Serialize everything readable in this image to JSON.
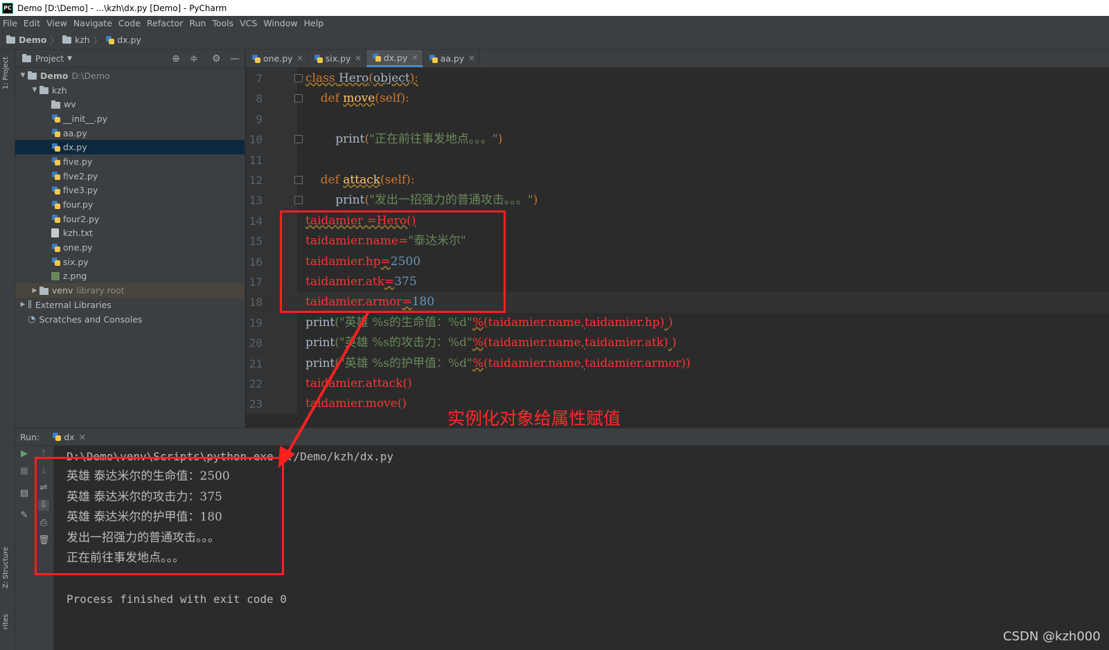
{
  "window": {
    "title": "Demo [D:\\Demo] - ...\\kzh\\dx.py [Demo] - PyCharm",
    "logo_text": "PC"
  },
  "menu": [
    "File",
    "Edit",
    "View",
    "Navigate",
    "Code",
    "Refactor",
    "Run",
    "Tools",
    "VCS",
    "Window",
    "Help"
  ],
  "breadcrumb": {
    "project": "Demo",
    "folder": "kzh",
    "file": "dx.py"
  },
  "left_tool_tabs": {
    "project": "1: Project",
    "structure": "Z: Structure",
    "favorites": "rites"
  },
  "project_panel": {
    "title": "Project",
    "tree": [
      {
        "indent": 0,
        "arrow": "▼",
        "icon": "folder",
        "label": "Demo",
        "extra": "D:\\Demo",
        "bold": true
      },
      {
        "indent": 1,
        "arrow": "▼",
        "icon": "folder",
        "label": "kzh"
      },
      {
        "indent": 2,
        "arrow": "",
        "icon": "folder",
        "label": "wv"
      },
      {
        "indent": 2,
        "arrow": "",
        "icon": "py",
        "label": "__init__.py"
      },
      {
        "indent": 2,
        "arrow": "",
        "icon": "py",
        "label": "aa.py"
      },
      {
        "indent": 2,
        "arrow": "",
        "icon": "py",
        "label": "dx.py",
        "selected": true
      },
      {
        "indent": 2,
        "arrow": "",
        "icon": "py",
        "label": "five.py"
      },
      {
        "indent": 2,
        "arrow": "",
        "icon": "py",
        "label": "five2.py"
      },
      {
        "indent": 2,
        "arrow": "",
        "icon": "py",
        "label": "five3.py"
      },
      {
        "indent": 2,
        "arrow": "",
        "icon": "py",
        "label": "four.py"
      },
      {
        "indent": 2,
        "arrow": "",
        "icon": "py",
        "label": "four2.py"
      },
      {
        "indent": 2,
        "arrow": "",
        "icon": "txt",
        "label": "kzh.txt"
      },
      {
        "indent": 2,
        "arrow": "",
        "icon": "py",
        "label": "one.py"
      },
      {
        "indent": 2,
        "arrow": "",
        "icon": "py",
        "label": "six.py"
      },
      {
        "indent": 2,
        "arrow": "",
        "icon": "img",
        "label": "z.png"
      },
      {
        "indent": 1,
        "arrow": "▶",
        "icon": "folder",
        "label": "venv",
        "extra": "library root",
        "venv": true
      },
      {
        "indent": 0,
        "arrow": "▶",
        "icon": "lib",
        "label": "External Libraries"
      },
      {
        "indent": 0,
        "arrow": "",
        "icon": "scratch",
        "label": "Scratches and Consoles"
      }
    ]
  },
  "editor_tabs": [
    {
      "label": "one.py",
      "active": false
    },
    {
      "label": "six.py",
      "active": false
    },
    {
      "label": "dx.py",
      "active": true
    },
    {
      "label": "aa.py",
      "active": false
    }
  ],
  "code_lines": [
    {
      "num": "7",
      "tokens": [
        [
          "k sq",
          "class "
        ],
        [
          "sq",
          "Hero"
        ],
        [
          "k sq",
          "("
        ],
        [
          "sq",
          "object"
        ],
        [
          "k sq",
          "):"
        ]
      ],
      "fold": true
    },
    {
      "num": "8",
      "tokens": [
        [
          "",
          "    "
        ],
        [
          "k",
          "def "
        ],
        [
          "f sq",
          "move"
        ],
        [
          "k",
          "(self):"
        ]
      ],
      "fold": true
    },
    {
      "num": "9",
      "tokens": []
    },
    {
      "num": "10",
      "tokens": [
        [
          "",
          "        print"
        ],
        [
          "k",
          "("
        ],
        [
          "s",
          "\"正在前往事发地点。。。\""
        ],
        [
          "k",
          ")"
        ]
      ],
      "fold": true
    },
    {
      "num": "11",
      "tokens": []
    },
    {
      "num": "12",
      "tokens": [
        [
          "",
          "    "
        ],
        [
          "k",
          "def "
        ],
        [
          "f sq",
          "attack"
        ],
        [
          "k",
          "(self):"
        ]
      ],
      "fold": true
    },
    {
      "num": "13",
      "tokens": [
        [
          "",
          "        print"
        ],
        [
          "k",
          "("
        ],
        [
          "s",
          "\"发出一招强力的普通攻击。。。\""
        ],
        [
          "k",
          ")"
        ]
      ],
      "fold": true
    },
    {
      "num": "14",
      "tokens": [
        [
          "r sq",
          "taidamier =Hero()"
        ]
      ]
    },
    {
      "num": "15",
      "tokens": [
        [
          "r",
          "taidamier.name="
        ],
        [
          "s",
          "\"泰达米尔\""
        ]
      ]
    },
    {
      "num": "16",
      "tokens": [
        [
          "r",
          "taidamier.hp"
        ],
        [
          "r sq",
          "="
        ],
        [
          "n",
          "2500"
        ]
      ]
    },
    {
      "num": "17",
      "tokens": [
        [
          "r",
          "taidamier.atk"
        ],
        [
          "r sq",
          "="
        ],
        [
          "n",
          "375"
        ]
      ]
    },
    {
      "num": "18",
      "tokens": [
        [
          "r",
          "taidamier.armor"
        ],
        [
          "r sq",
          "="
        ],
        [
          "n",
          "180"
        ]
      ],
      "current": true
    },
    {
      "num": "19",
      "tokens": [
        [
          "",
          "print"
        ],
        [
          "s",
          "(\"英雄 %s的生命值：%d\""
        ],
        [
          "r sq",
          "%"
        ],
        [
          "r",
          "(taidamier.name"
        ],
        [
          "r sq",
          ","
        ],
        [
          "r",
          "taidamier.hp)"
        ],
        [
          "r sq",
          " "
        ],
        [
          "r",
          ")"
        ]
      ]
    },
    {
      "num": "20",
      "tokens": [
        [
          "",
          "print"
        ],
        [
          "s",
          "(\"英雄 %s的攻击力：%d\""
        ],
        [
          "r sq",
          "%"
        ],
        [
          "r",
          "(taidamier.name"
        ],
        [
          "r sq",
          ","
        ],
        [
          "r",
          "taidamier.atk)"
        ],
        [
          "r sq",
          " "
        ],
        [
          "r",
          ")"
        ]
      ]
    },
    {
      "num": "21",
      "tokens": [
        [
          "",
          "print"
        ],
        [
          "s",
          "(\"英雄 %s的护甲值：%d\""
        ],
        [
          "r sq",
          "%"
        ],
        [
          "r",
          "(taidamier.name"
        ],
        [
          "r sq",
          ","
        ],
        [
          "r",
          "taidamier.armor))"
        ]
      ]
    },
    {
      "num": "22",
      "tokens": [
        [
          "r",
          "taidamier.attack()"
        ]
      ]
    },
    {
      "num": "23",
      "tokens": [
        [
          "r",
          "taidamier.move()"
        ]
      ]
    }
  ],
  "run_panel": {
    "label": "Run:",
    "tab": "dx"
  },
  "console_lines": [
    {
      "text": "D:\\Demo\\venv\\Scripts\\python.exe D:/Demo/kzh/dx.py",
      "mono": true
    },
    {
      "text": "英雄 泰达米尔的生命值：2500"
    },
    {
      "text": "英雄 泰达米尔的攻击力：375"
    },
    {
      "text": "英雄 泰达米尔的护甲值：180"
    },
    {
      "text": "发出一招强力的普通攻击。。。"
    },
    {
      "text": "正在前往事发地点。。。"
    },
    {
      "text": ""
    },
    {
      "text": "Process finished with exit code 0",
      "mono": true
    }
  ],
  "annotation": {
    "label": "实例化对象给属性赋值",
    "color": "#ff2020"
  },
  "watermark": "CSDN @kzh000",
  "colors": {
    "keyword": "#cc7832",
    "function": "#ffc66d",
    "string": "#6a8759",
    "number": "#6897bb",
    "error": "#ff3333",
    "selection": "#0d293e"
  }
}
